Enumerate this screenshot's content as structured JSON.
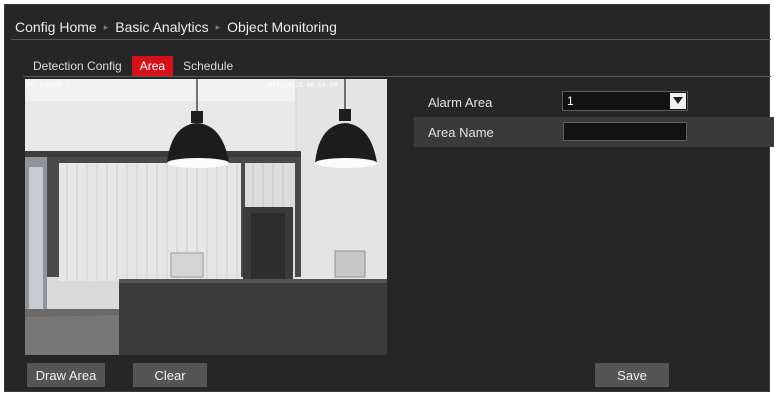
{
  "breadcrumb": {
    "items": [
      "Config Home",
      "Basic Analytics",
      "Object Monitoring"
    ],
    "separator": "▸"
  },
  "tabs": [
    {
      "label": "Detection Config",
      "active": false
    },
    {
      "label": "Area",
      "active": true
    },
    {
      "label": "Schedule",
      "active": false
    }
  ],
  "preview": {
    "osd_left": "BJ-ACMRSP-1",
    "osd_right": "2017/10/25  06:58:50"
  },
  "form": {
    "alarm_area_label": "Alarm Area",
    "alarm_area_value": "1",
    "area_name_label": "Area Name",
    "area_name_value": ""
  },
  "buttons": {
    "draw_area": "Draw Area",
    "clear": "Clear",
    "save": "Save"
  },
  "colors": {
    "accent_tab": "#d4111b",
    "panel_bg": "#262626",
    "button_bg": "#555555"
  }
}
